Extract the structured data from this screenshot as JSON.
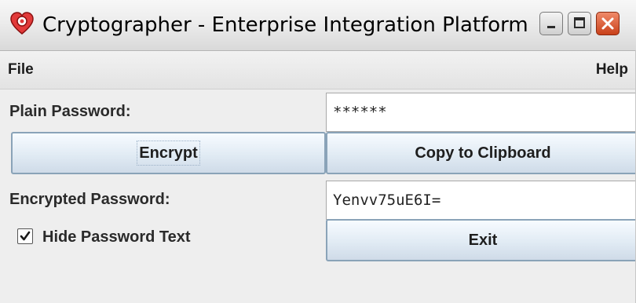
{
  "window": {
    "title": "Cryptographer - Enterprise Integration Platform",
    "icon": "heart-app-icon",
    "controls": [
      "minimize-icon",
      "maximize-icon",
      "close-icon"
    ]
  },
  "menu": {
    "file_label": "File",
    "help_label": "Help"
  },
  "form": {
    "plain_password_label": "Plain Password:",
    "plain_password_value": "******",
    "encrypt_button": "Encrypt",
    "copy_button": "Copy to Clipboard",
    "encrypted_password_label": "Encrypted Password:",
    "encrypted_password_value": "Yenvv75uE6I=",
    "hide_password_label": "Hide Password Text",
    "hide_password_checked": true,
    "exit_button": "Exit"
  },
  "colors": {
    "button_border": "#8aa3b8",
    "close_button": "#c9411a"
  }
}
